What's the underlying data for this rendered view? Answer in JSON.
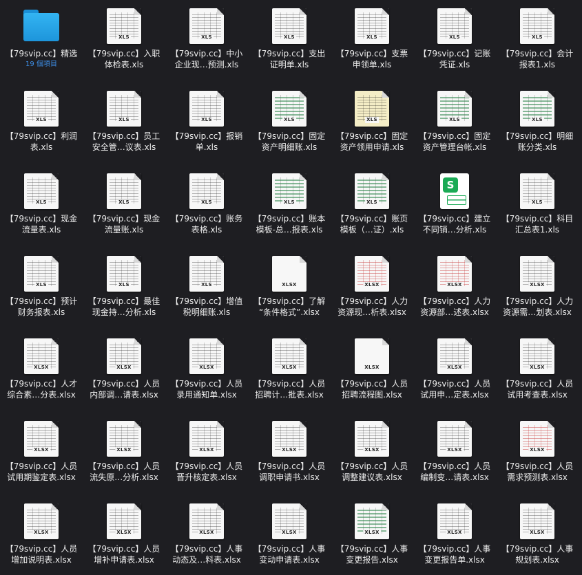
{
  "colors": {
    "background": "#1e1e22",
    "text": "#ececec",
    "accent": "#3d8ee6"
  },
  "items": [
    {
      "kind": "folder",
      "line1": "【79svip.cc】精选",
      "line2": "",
      "sub": "19 個項目",
      "ext": ""
    },
    {
      "kind": "file",
      "style": "plain",
      "line1": "【79svip.cc】入职",
      "line2": "体检表.xls",
      "ext": "XLS"
    },
    {
      "kind": "file",
      "style": "plain",
      "line1": "【79svip.cc】中小",
      "line2": "企业现…预测.xls",
      "ext": "XLS"
    },
    {
      "kind": "file",
      "style": "plain",
      "line1": "【79svip.cc】支出",
      "line2": "证明单.xls",
      "ext": "XLS"
    },
    {
      "kind": "file",
      "style": "plain",
      "line1": "【79svip.cc】支票",
      "line2": "申领单.xls",
      "ext": "XLS"
    },
    {
      "kind": "file",
      "style": "plain",
      "line1": "【79svip.cc】记账",
      "line2": "凭证.xls",
      "ext": "XLS"
    },
    {
      "kind": "file",
      "style": "plain",
      "line1": "【79svip.cc】会计",
      "line2": "报表1.xls",
      "ext": "XLS"
    },
    {
      "kind": "file",
      "style": "plain",
      "line1": "【79svip.cc】利润",
      "line2": "表.xls",
      "ext": "XLS"
    },
    {
      "kind": "file",
      "style": "plain",
      "line1": "【79svip.cc】员工",
      "line2": "安全管…议表.xls",
      "ext": "XLS"
    },
    {
      "kind": "file",
      "style": "plain",
      "line1": "【79svip.cc】报销",
      "line2": "单.xls",
      "ext": "XLS"
    },
    {
      "kind": "file",
      "style": "green",
      "line1": "【79svip.cc】固定",
      "line2": "资产明细账.xls",
      "ext": "XLS"
    },
    {
      "kind": "file",
      "style": "yellow",
      "line1": "【79svip.cc】固定",
      "line2": "资产领用申请.xls",
      "ext": "XLS"
    },
    {
      "kind": "file",
      "style": "green",
      "line1": "【79svip.cc】固定",
      "line2": "资产管理台帐.xls",
      "ext": "XLS"
    },
    {
      "kind": "file",
      "style": "green",
      "line1": "【79svip.cc】明细",
      "line2": "账分类.xls",
      "ext": "XLS"
    },
    {
      "kind": "file",
      "style": "plain",
      "line1": "【79svip.cc】现金",
      "line2": "流量表.xls",
      "ext": "XLS"
    },
    {
      "kind": "file",
      "style": "plain",
      "line1": "【79svip.cc】现金",
      "line2": "流量账.xls",
      "ext": "XLS"
    },
    {
      "kind": "file",
      "style": "plain",
      "line1": "【79svip.cc】账务",
      "line2": "表格.xls",
      "ext": "XLS"
    },
    {
      "kind": "file",
      "style": "green",
      "line1": "【79svip.cc】账本",
      "line2": "模板-总…报表.xls",
      "ext": "XLS"
    },
    {
      "kind": "file",
      "style": "green",
      "line1": "【79svip.cc】账页",
      "line2": "模板（…证）.xls",
      "ext": "XLS"
    },
    {
      "kind": "sapp",
      "line1": "【79svip.cc】建立",
      "line2": "不同销…分析.xls",
      "ext": ""
    },
    {
      "kind": "file",
      "style": "plain",
      "line1": "【79svip.cc】科目",
      "line2": "汇总表1.xls",
      "ext": "XLS"
    },
    {
      "kind": "file",
      "style": "plain",
      "line1": "【79svip.cc】预计",
      "line2": "财务报表.xls",
      "ext": "XLS"
    },
    {
      "kind": "file",
      "style": "plain",
      "line1": "【79svip.cc】最佳",
      "line2": "现金持…分析.xls",
      "ext": "XLS"
    },
    {
      "kind": "file",
      "style": "plain",
      "line1": "【79svip.cc】增值",
      "line2": "税明细账.xls",
      "ext": "XLS"
    },
    {
      "kind": "file",
      "style": "blank",
      "line1": "【79svip.cc】了解",
      "line2": "“条件格式”.xlsx",
      "ext": "XLSX"
    },
    {
      "kind": "file",
      "style": "red",
      "line1": "【79svip.cc】人力",
      "line2": "资源现…析表.xlsx",
      "ext": "XLSX"
    },
    {
      "kind": "file",
      "style": "red",
      "line1": "【79svip.cc】人力",
      "line2": "资源部…述表.xlsx",
      "ext": "XLSX"
    },
    {
      "kind": "file",
      "style": "plain",
      "line1": "【79svip.cc】人力",
      "line2": "资源需…划表.xlsx",
      "ext": "XLSX"
    },
    {
      "kind": "file",
      "style": "plain",
      "line1": "【79svip.cc】人才",
      "line2": "综合素…分表.xlsx",
      "ext": "XLSX"
    },
    {
      "kind": "file",
      "style": "plain",
      "line1": "【79svip.cc】人员",
      "line2": "内部调…请表.xlsx",
      "ext": "XLSX"
    },
    {
      "kind": "file",
      "style": "plain",
      "line1": "【79svip.cc】人员",
      "line2": "录用通知单.xlsx",
      "ext": "XLSX"
    },
    {
      "kind": "file",
      "style": "plain",
      "line1": "【79svip.cc】人员",
      "line2": "招聘计…批表.xlsx",
      "ext": "XLSX"
    },
    {
      "kind": "file",
      "style": "blank",
      "line1": "【79svip.cc】人员",
      "line2": "招聘流程图.xlsx",
      "ext": "XLSX"
    },
    {
      "kind": "file",
      "style": "plain",
      "line1": "【79svip.cc】人员",
      "line2": "试用申…定表.xlsx",
      "ext": "XLSX"
    },
    {
      "kind": "file",
      "style": "plain",
      "line1": "【79svip.cc】人员",
      "line2": "试用考查表.xlsx",
      "ext": "XLSX"
    },
    {
      "kind": "file",
      "style": "plain",
      "line1": "【79svip.cc】人员",
      "line2": "试用期鉴定表.xlsx",
      "ext": "XLSX"
    },
    {
      "kind": "file",
      "style": "plain",
      "line1": "【79svip.cc】人员",
      "line2": "流失原…分析.xlsx",
      "ext": "XLSX"
    },
    {
      "kind": "file",
      "style": "plain",
      "line1": "【79svip.cc】人员",
      "line2": "晋升核定表.xlsx",
      "ext": "XLSX"
    },
    {
      "kind": "file",
      "style": "plain",
      "line1": "【79svip.cc】人员",
      "line2": "调职申请书.xlsx",
      "ext": "XLSX"
    },
    {
      "kind": "file",
      "style": "plain",
      "line1": "【79svip.cc】人员",
      "line2": "调整建议表.xlsx",
      "ext": "XLSX"
    },
    {
      "kind": "file",
      "style": "plain",
      "line1": "【79svip.cc】人员",
      "line2": "编制变…请表.xlsx",
      "ext": "XLSX"
    },
    {
      "kind": "file",
      "style": "red",
      "line1": "【79svip.cc】人员",
      "line2": "需求预测表.xlsx",
      "ext": "XLSX"
    },
    {
      "kind": "file",
      "style": "plain",
      "line1": "【79svip.cc】人员",
      "line2": "增加说明表.xlsx",
      "ext": "XLSX"
    },
    {
      "kind": "file",
      "style": "plain",
      "line1": "【79svip.cc】人员",
      "line2": "增补申请表.xlsx",
      "ext": "XLSX"
    },
    {
      "kind": "file",
      "style": "plain",
      "line1": "【79svip.cc】人事",
      "line2": "动态及…料表.xlsx",
      "ext": "XLSX"
    },
    {
      "kind": "file",
      "style": "plain",
      "line1": "【79svip.cc】人事",
      "line2": "变动申请表.xlsx",
      "ext": "XLSX"
    },
    {
      "kind": "file",
      "style": "green",
      "line1": "【79svip.cc】人事",
      "line2": "变更报告.xlsx",
      "ext": "XLSX"
    },
    {
      "kind": "file",
      "style": "plain",
      "line1": "【79svip.cc】人事",
      "line2": "变更报告单.xlsx",
      "ext": "XLSX"
    },
    {
      "kind": "file",
      "style": "plain",
      "line1": "【79svip.cc】人事",
      "line2": "规划表.xlsx",
      "ext": "XLSX"
    }
  ]
}
